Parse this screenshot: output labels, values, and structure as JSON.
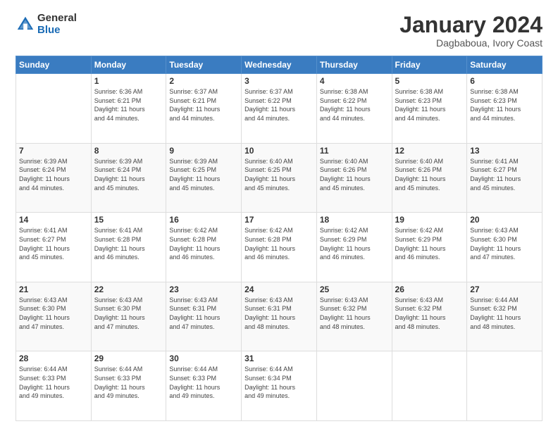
{
  "logo": {
    "general": "General",
    "blue": "Blue"
  },
  "title": {
    "month": "January 2024",
    "location": "Dagbaboua, Ivory Coast"
  },
  "weekdays": [
    "Sunday",
    "Monday",
    "Tuesday",
    "Wednesday",
    "Thursday",
    "Friday",
    "Saturday"
  ],
  "weeks": [
    [
      {
        "day": "",
        "info": ""
      },
      {
        "day": "1",
        "info": "Sunrise: 6:36 AM\nSunset: 6:21 PM\nDaylight: 11 hours\nand 44 minutes."
      },
      {
        "day": "2",
        "info": "Sunrise: 6:37 AM\nSunset: 6:21 PM\nDaylight: 11 hours\nand 44 minutes."
      },
      {
        "day": "3",
        "info": "Sunrise: 6:37 AM\nSunset: 6:22 PM\nDaylight: 11 hours\nand 44 minutes."
      },
      {
        "day": "4",
        "info": "Sunrise: 6:38 AM\nSunset: 6:22 PM\nDaylight: 11 hours\nand 44 minutes."
      },
      {
        "day": "5",
        "info": "Sunrise: 6:38 AM\nSunset: 6:23 PM\nDaylight: 11 hours\nand 44 minutes."
      },
      {
        "day": "6",
        "info": "Sunrise: 6:38 AM\nSunset: 6:23 PM\nDaylight: 11 hours\nand 44 minutes."
      }
    ],
    [
      {
        "day": "7",
        "info": "Sunrise: 6:39 AM\nSunset: 6:24 PM\nDaylight: 11 hours\nand 44 minutes."
      },
      {
        "day": "8",
        "info": "Sunrise: 6:39 AM\nSunset: 6:24 PM\nDaylight: 11 hours\nand 45 minutes."
      },
      {
        "day": "9",
        "info": "Sunrise: 6:39 AM\nSunset: 6:25 PM\nDaylight: 11 hours\nand 45 minutes."
      },
      {
        "day": "10",
        "info": "Sunrise: 6:40 AM\nSunset: 6:25 PM\nDaylight: 11 hours\nand 45 minutes."
      },
      {
        "day": "11",
        "info": "Sunrise: 6:40 AM\nSunset: 6:26 PM\nDaylight: 11 hours\nand 45 minutes."
      },
      {
        "day": "12",
        "info": "Sunrise: 6:40 AM\nSunset: 6:26 PM\nDaylight: 11 hours\nand 45 minutes."
      },
      {
        "day": "13",
        "info": "Sunrise: 6:41 AM\nSunset: 6:27 PM\nDaylight: 11 hours\nand 45 minutes."
      }
    ],
    [
      {
        "day": "14",
        "info": "Sunrise: 6:41 AM\nSunset: 6:27 PM\nDaylight: 11 hours\nand 45 minutes."
      },
      {
        "day": "15",
        "info": "Sunrise: 6:41 AM\nSunset: 6:28 PM\nDaylight: 11 hours\nand 46 minutes."
      },
      {
        "day": "16",
        "info": "Sunrise: 6:42 AM\nSunset: 6:28 PM\nDaylight: 11 hours\nand 46 minutes."
      },
      {
        "day": "17",
        "info": "Sunrise: 6:42 AM\nSunset: 6:28 PM\nDaylight: 11 hours\nand 46 minutes."
      },
      {
        "day": "18",
        "info": "Sunrise: 6:42 AM\nSunset: 6:29 PM\nDaylight: 11 hours\nand 46 minutes."
      },
      {
        "day": "19",
        "info": "Sunrise: 6:42 AM\nSunset: 6:29 PM\nDaylight: 11 hours\nand 46 minutes."
      },
      {
        "day": "20",
        "info": "Sunrise: 6:43 AM\nSunset: 6:30 PM\nDaylight: 11 hours\nand 47 minutes."
      }
    ],
    [
      {
        "day": "21",
        "info": "Sunrise: 6:43 AM\nSunset: 6:30 PM\nDaylight: 11 hours\nand 47 minutes."
      },
      {
        "day": "22",
        "info": "Sunrise: 6:43 AM\nSunset: 6:30 PM\nDaylight: 11 hours\nand 47 minutes."
      },
      {
        "day": "23",
        "info": "Sunrise: 6:43 AM\nSunset: 6:31 PM\nDaylight: 11 hours\nand 47 minutes."
      },
      {
        "day": "24",
        "info": "Sunrise: 6:43 AM\nSunset: 6:31 PM\nDaylight: 11 hours\nand 48 minutes."
      },
      {
        "day": "25",
        "info": "Sunrise: 6:43 AM\nSunset: 6:32 PM\nDaylight: 11 hours\nand 48 minutes."
      },
      {
        "day": "26",
        "info": "Sunrise: 6:43 AM\nSunset: 6:32 PM\nDaylight: 11 hours\nand 48 minutes."
      },
      {
        "day": "27",
        "info": "Sunrise: 6:44 AM\nSunset: 6:32 PM\nDaylight: 11 hours\nand 48 minutes."
      }
    ],
    [
      {
        "day": "28",
        "info": "Sunrise: 6:44 AM\nSunset: 6:33 PM\nDaylight: 11 hours\nand 49 minutes."
      },
      {
        "day": "29",
        "info": "Sunrise: 6:44 AM\nSunset: 6:33 PM\nDaylight: 11 hours\nand 49 minutes."
      },
      {
        "day": "30",
        "info": "Sunrise: 6:44 AM\nSunset: 6:33 PM\nDaylight: 11 hours\nand 49 minutes."
      },
      {
        "day": "31",
        "info": "Sunrise: 6:44 AM\nSunset: 6:34 PM\nDaylight: 11 hours\nand 49 minutes."
      },
      {
        "day": "",
        "info": ""
      },
      {
        "day": "",
        "info": ""
      },
      {
        "day": "",
        "info": ""
      }
    ]
  ]
}
